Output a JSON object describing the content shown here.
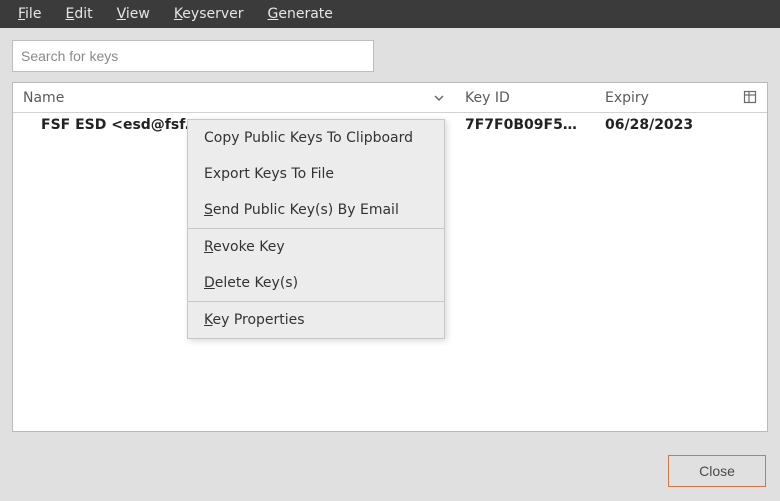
{
  "menubar": {
    "file": {
      "label": "File",
      "accel": "F"
    },
    "edit": {
      "label": "Edit",
      "accel": "E"
    },
    "view": {
      "label": "View",
      "accel": "V"
    },
    "keyserver": {
      "label": "Keyserver",
      "accel": "K"
    },
    "generate": {
      "label": "Generate",
      "accel": "G"
    }
  },
  "search": {
    "placeholder": "Search for keys"
  },
  "columns": {
    "name": "Name",
    "keyid": "Key ID",
    "expiry": "Expiry"
  },
  "rows": [
    {
      "name": "FSF ESD <esd@fsf.org>",
      "keyid": "7F7F0B09F52…",
      "expiry": "06/28/2023"
    }
  ],
  "context_menu": {
    "copy": {
      "label": "Copy Public Keys To Clipboard"
    },
    "export": {
      "label": "Export Keys To File"
    },
    "send": {
      "label": "Send Public Key(s) By Email",
      "accel": "S"
    },
    "revoke": {
      "label": "Revoke Key",
      "accel": "R"
    },
    "delete": {
      "label": "Delete Key(s)",
      "accel": "D"
    },
    "props": {
      "label": "Key Properties",
      "accel": "K"
    }
  },
  "buttons": {
    "close": "Close"
  }
}
